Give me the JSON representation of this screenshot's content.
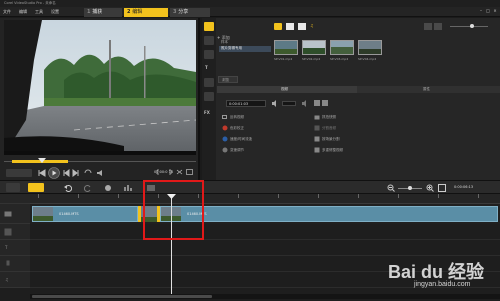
{
  "app": {
    "title": "Corel VideoStudio Pro - 未命名"
  },
  "menu": {
    "items": [
      "文件",
      "编辑",
      "工具",
      "设置"
    ]
  },
  "steps": {
    "capture": "捕获",
    "edit": "编辑",
    "share": "分享"
  },
  "window_controls": {
    "minimize": "–",
    "maximize": "□",
    "close": "×"
  },
  "preview": {
    "timecode": "00:00:0 16",
    "project_label": "",
    "clip_label": ""
  },
  "library": {
    "add_label": "添加",
    "folders": [
      "样本",
      "照片剪辑专用"
    ],
    "thumbnails": [
      {
        "label": "SP-V01.mp4"
      },
      {
        "label": "SP-V02.mp4"
      },
      {
        "label": "SP-V03.mp4"
      },
      {
        "label": "SP-V04.mp4"
      }
    ],
    "browse_label": "浏览"
  },
  "options": {
    "tab_video": "视频",
    "tab_attribute": "属性",
    "timecode": "0:00:01:03",
    "left_items": [
      "反转视频",
      "色彩校正",
      "速度/时间流逝",
      "变速调节"
    ],
    "right_items": [
      "抓拍快照",
      "分割音频",
      "按场景分割",
      "多重修整视频"
    ]
  },
  "timeline": {
    "tracks": [
      {
        "clips": [
          {
            "label": "01460.MTS"
          },
          {
            "label": "01460.MTS"
          }
        ]
      }
    ],
    "timecode": "0:00:06:13"
  },
  "colors": {
    "accent": "#f2c21d",
    "clip_bg": "#5a8ea6",
    "selection": "#e11919",
    "panel": "#262626"
  },
  "watermark": {
    "text": "Bai du 经验",
    "url": "jingyan.baidu.com"
  }
}
